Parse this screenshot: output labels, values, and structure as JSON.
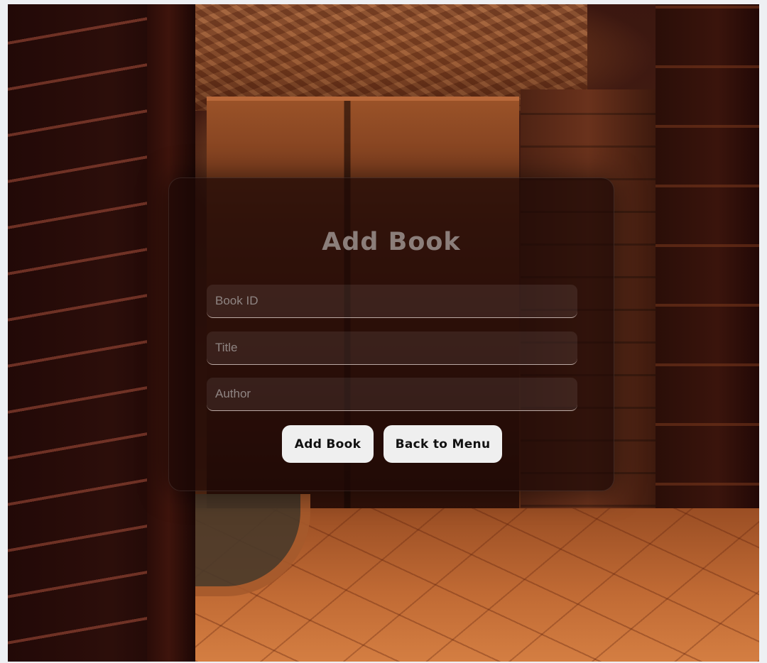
{
  "form": {
    "title": "Add Book",
    "fields": [
      {
        "name": "book-id",
        "placeholder": "Book ID",
        "value": ""
      },
      {
        "name": "title",
        "placeholder": "Title",
        "value": ""
      },
      {
        "name": "author",
        "placeholder": "Author",
        "value": ""
      }
    ],
    "buttons": {
      "submit_label": "Add Book",
      "back_label": "Back to Menu"
    }
  },
  "colors": {
    "card_background": "#1c0806",
    "title_text": "#8b7e7a",
    "button_background": "#efefef",
    "button_text": "#111111"
  }
}
